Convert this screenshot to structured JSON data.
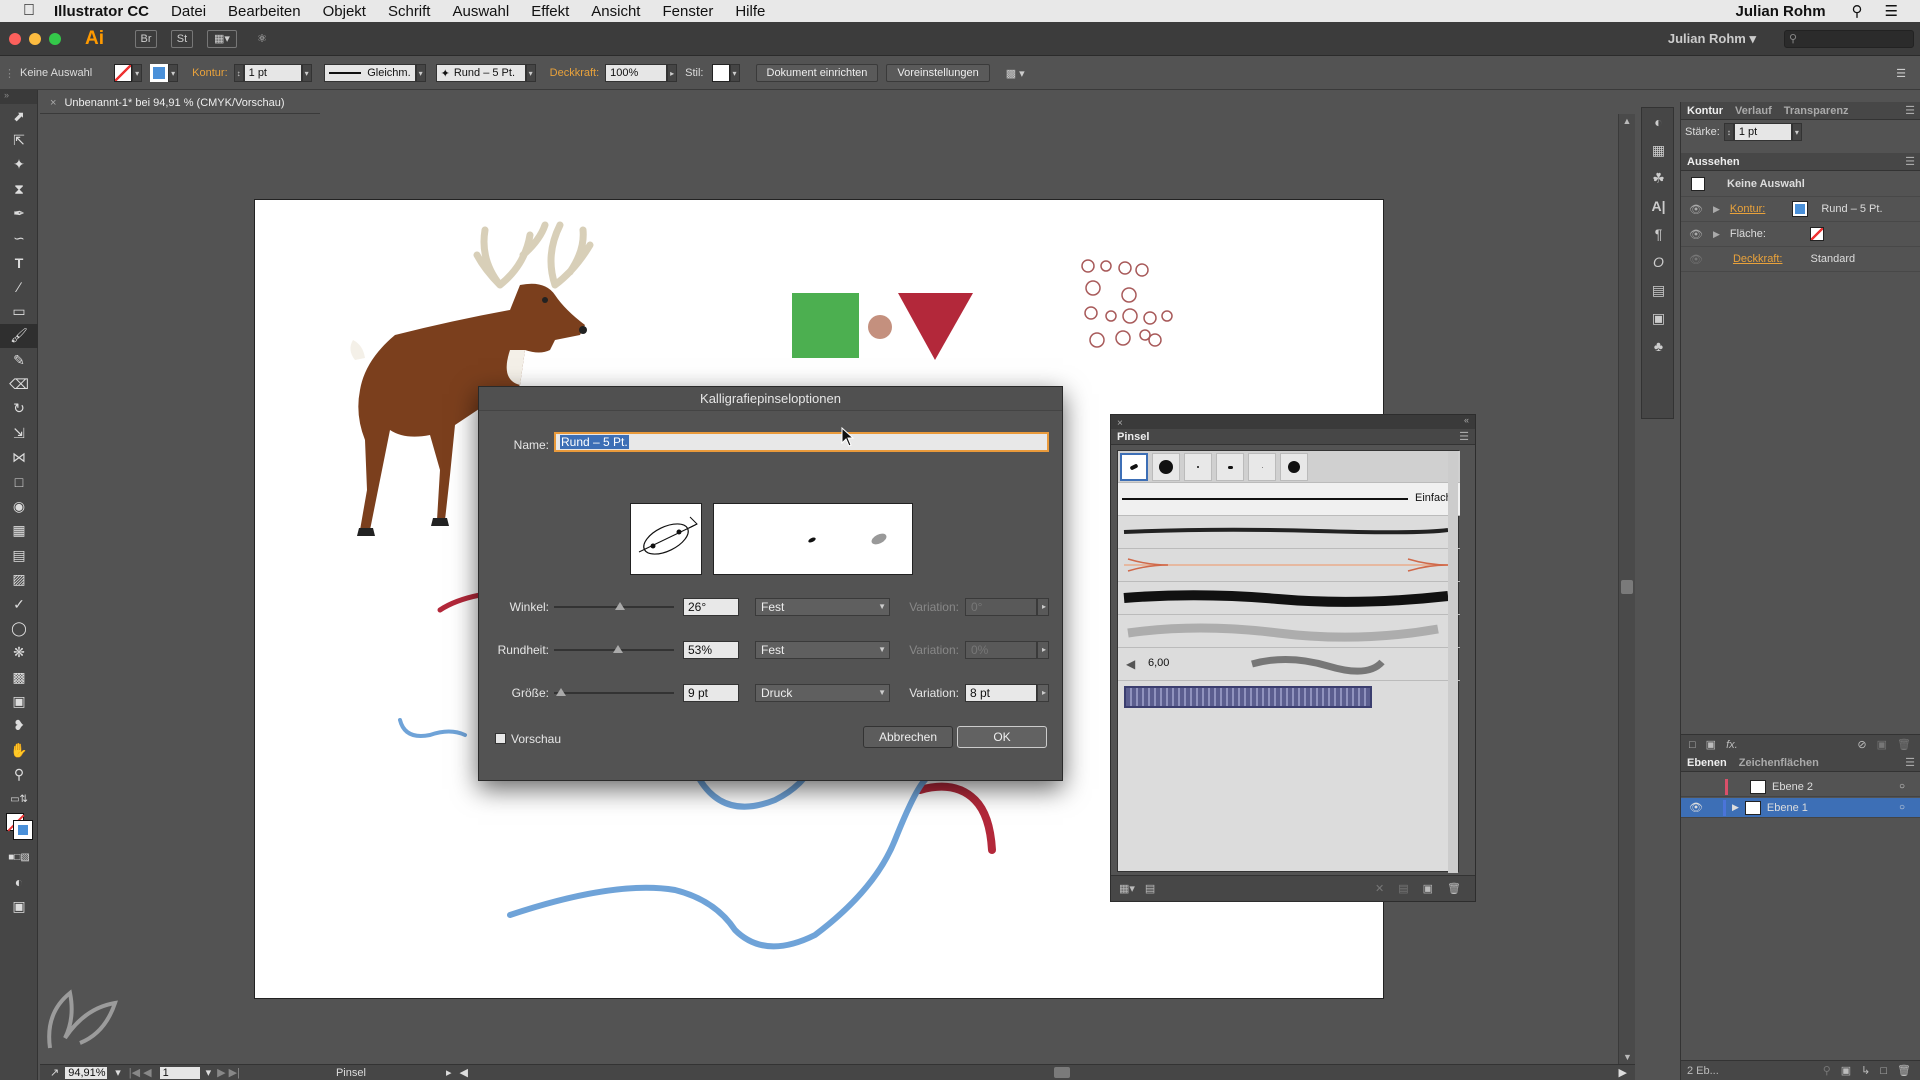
{
  "menubar": {
    "app_name": "Illustrator CC",
    "items": [
      "Datei",
      "Bearbeiten",
      "Objekt",
      "Schrift",
      "Auswahl",
      "Effekt",
      "Ansicht",
      "Fenster",
      "Hilfe"
    ],
    "user": "Julian Rohm"
  },
  "appbar": {
    "logo": "Ai",
    "br": "Br",
    "st": "St",
    "workspace": "Julian Rohm"
  },
  "control": {
    "selection": "Keine Auswahl",
    "kontur_label": "Kontur:",
    "stroke_weight": "1 pt",
    "stroke_profile": "Gleichm.",
    "brush": "Rund – 5 Pt.",
    "opacity_label": "Deckkraft:",
    "opacity": "100%",
    "style_label": "Stil:",
    "doc_setup": "Dokument einrichten",
    "prefs": "Voreinstellungen"
  },
  "document": {
    "tab_title": "Unbenannt-1* bei 94,91 % (CMYK/Vorschau)"
  },
  "dialog": {
    "title": "Kalligrafiepinseloptionen",
    "name_label": "Name:",
    "name_value": "Rund – 5 Pt.",
    "angle_label": "Winkel:",
    "angle_value": "26°",
    "angle_mode": "Fest",
    "roundness_label": "Rundheit:",
    "roundness_value": "53%",
    "roundness_mode": "Fest",
    "size_label": "Größe:",
    "size_value": "9 pt",
    "size_mode": "Druck",
    "variation_label": "Variation:",
    "angle_variation": "0°",
    "roundness_variation": "0%",
    "size_variation": "8 pt",
    "preview_label": "Vorschau",
    "cancel": "Abbrechen",
    "ok": "OK",
    "angle_slider": 0.55,
    "roundness_slider": 0.53,
    "size_slider": 0.06
  },
  "brush_panel": {
    "title": "Pinsel",
    "basic_label": "Einfach",
    "pattern_value": "6,00"
  },
  "stroke_panel": {
    "tabs": [
      "Kontur",
      "Verlauf",
      "Transparenz"
    ],
    "weight_label": "Stärke:",
    "weight_value": "1 pt"
  },
  "appearance_panel": {
    "title": "Aussehen",
    "selection": "Keine Auswahl",
    "kontur_label": "Kontur:",
    "kontur_value": "Rund – 5 Pt.",
    "flaeche_label": "Fläche:",
    "deckkraft_label": "Deckkraft:",
    "deckkraft_value": "Standard"
  },
  "layers_panel": {
    "tabs": [
      "Ebenen",
      "Zeichenflächen"
    ],
    "layers": [
      "Ebene 2",
      "Ebene 1"
    ],
    "count": "2 Eb..."
  },
  "status": {
    "zoom": "94,91%",
    "page": "1",
    "tool": "Pinsel"
  },
  "colors": {
    "accent_orange": "#e9a23b",
    "selection_blue": "#3d6fb6",
    "green": "#4caf50",
    "red": "#b3283a",
    "blue_stroke": "#6fa3d8",
    "deer_brown": "#7b3f1d"
  }
}
